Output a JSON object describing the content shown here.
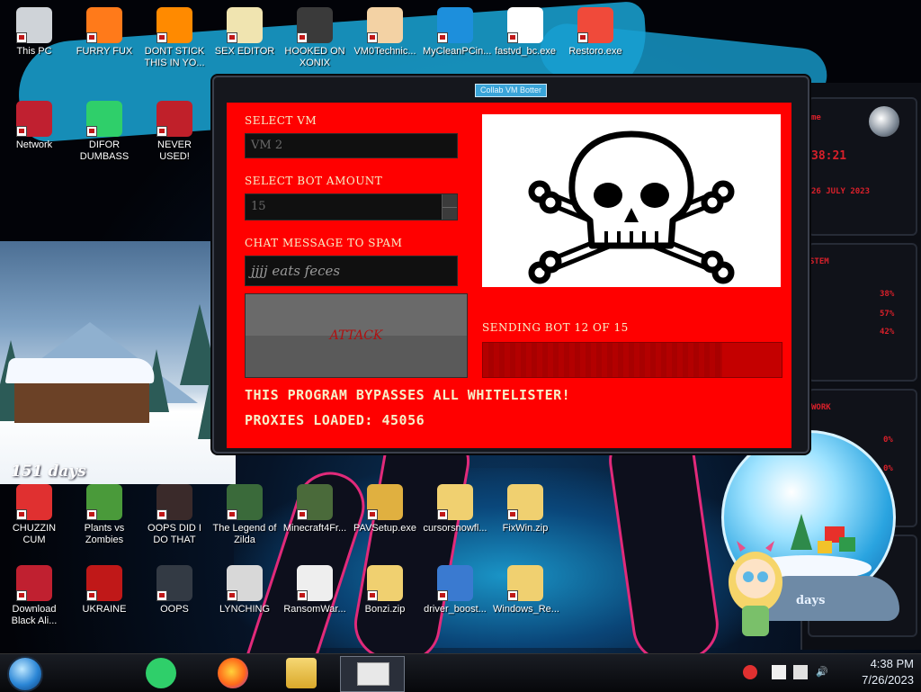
{
  "desktop": {
    "icons": [
      {
        "label": "This PC",
        "icon": "computer-icon",
        "color": "#cfd3d8"
      },
      {
        "label": "FURRY FUX",
        "icon": "firefox-icon",
        "color": "#ff7a1a"
      },
      {
        "label": "DONT STICK THIS IN YO...",
        "icon": "vlc-cone-icon",
        "color": "#ff8a00"
      },
      {
        "label": "SEX EDITOR",
        "icon": "hxd-icon",
        "color": "#f0e4b0"
      },
      {
        "label": "HOOKED ON XONIX",
        "icon": "xonix-icon",
        "color": "#3a3a3a"
      },
      {
        "label": "VM0Technic...",
        "icon": "doctor-icon",
        "color": "#f3d2a4"
      },
      {
        "label": "MyCleanPCin...",
        "icon": "broom-icon",
        "color": "#1d8fdc"
      },
      {
        "label": "fastvd_bc.exe",
        "icon": "fast-video-icon",
        "color": "#ffffff"
      },
      {
        "label": "Restoro.exe",
        "icon": "restoro-icon",
        "color": "#f04a3a"
      },
      {
        "label": "Network",
        "icon": "alienware-icon",
        "color": "#c02030"
      },
      {
        "label": "DIFOR DUMBASS",
        "icon": "spotify-notes-icon",
        "color": "#2fcf6a"
      },
      {
        "label": "NEVER USED!",
        "icon": "dev-cpp-icon",
        "color": "#c0202a"
      },
      {
        "label": "CHUZZIN CUM",
        "icon": "chuzzle-icon",
        "color": "#e03030"
      },
      {
        "label": "Plants vs Zombies",
        "icon": "pvz-icon",
        "color": "#4a9a3a"
      },
      {
        "label": "OOPS DID I DO THAT",
        "icon": "portrait-icon",
        "color": "#3a2a2a"
      },
      {
        "label": "The Legend of Zilda",
        "icon": "zelda-icon",
        "color": "#3a6a3a"
      },
      {
        "label": "Minecraft4Fr...",
        "icon": "minecraft-icon",
        "color": "#4a6a3a"
      },
      {
        "label": "PAVSetup.exe",
        "icon": "books-icon",
        "color": "#e0b040"
      },
      {
        "label": "cursorsnowfl...",
        "icon": "zip-folder-icon",
        "color": "#f0d070"
      },
      {
        "label": "FixWin.zip",
        "icon": "zip-folder-icon",
        "color": "#f0d070"
      },
      {
        "label": "Download Black Ali...",
        "icon": "alienware-icon",
        "color": "#c02030"
      },
      {
        "label": "UKRAINE",
        "icon": "radiation-icon",
        "color": "#c01818"
      },
      {
        "label": "OOPS",
        "icon": "film-icon",
        "color": "#333a44"
      },
      {
        "label": "LYNCHING",
        "icon": "rope-icon",
        "color": "#d8d8d8"
      },
      {
        "label": "RansomWar...",
        "icon": "skull-icon",
        "color": "#eeeeee"
      },
      {
        "label": "Bonzi.zip",
        "icon": "zip-folder-icon",
        "color": "#f0d070"
      },
      {
        "label": "driver_boost...",
        "icon": "iobit-icon",
        "color": "#3a7ad0"
      },
      {
        "label": "Windows_Re...",
        "icon": "zip-folder-icon",
        "color": "#f0d070"
      }
    ]
  },
  "app": {
    "window_title": "Collab VM Botter",
    "select_vm_label": "SELECT VM",
    "select_vm_value": "VM 2",
    "bot_amount_label": "SELECT BOT AMOUNT",
    "bot_amount_value": "15",
    "chat_label": "CHAT MESSAGE TO SPAM",
    "chat_value": "jjjj eats feces",
    "attack_label": "ATTACK",
    "status_text": "SENDING BOT 12 OF 15",
    "progress_fraction": 0.8,
    "bypass_text": "THIS PROGRAM BYPASSES ALL WHITELISTER!",
    "proxies_text": "PROXIES LOADED: 45056",
    "client_color": "#ff0000"
  },
  "widgets": {
    "countdown_left": "151 days",
    "countdown_globe": "days",
    "panel_time": "38:21",
    "panel_date": "26 JULY 2023",
    "panel_system": "STEM",
    "panel_network": "WORK",
    "panel_pcts": [
      "38%",
      "57%",
      "42%",
      "0%",
      "0%"
    ]
  },
  "taskbar": {
    "time": "4:38 PM",
    "date": "7/26/2023",
    "pinned": [
      "spotify-notes-icon",
      "firefox-icon",
      "file-explorer-icon"
    ]
  }
}
